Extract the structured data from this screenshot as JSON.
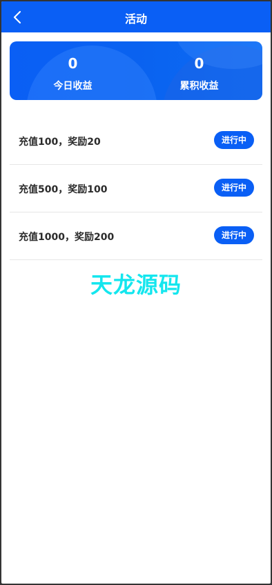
{
  "header": {
    "title": "活动"
  },
  "summary": {
    "today_value": "0",
    "today_label": "今日收益",
    "total_value": "0",
    "total_label": "累积收益"
  },
  "activities": [
    {
      "text": "充值100，奖励20",
      "status": "进行中"
    },
    {
      "text": "充值500，奖励100",
      "status": "进行中"
    },
    {
      "text": "充值1000，奖励200",
      "status": "进行中"
    }
  ],
  "watermark": "天龙源码",
  "colors": {
    "primary": "#0a5ff5",
    "watermark": "#14e6ee"
  }
}
